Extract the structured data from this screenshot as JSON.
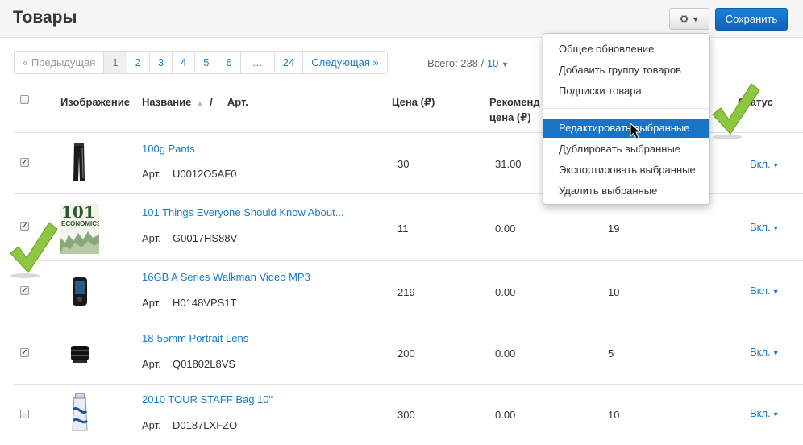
{
  "header": {
    "title": "Товары",
    "save_label": "Сохранить"
  },
  "pagination": {
    "prev": "« Предыдущая",
    "pages": [
      "1",
      "2",
      "3",
      "4",
      "5",
      "6",
      "…",
      "24"
    ],
    "active_page": "1",
    "next": "Следующая »",
    "total_label": "Всего: 238 /",
    "per_page": "10"
  },
  "table": {
    "headers": {
      "image": "Изображение",
      "name": "Название",
      "sort_indicator": "▲ /",
      "art": "Арт.",
      "price": "Цена (₽)",
      "recommended_line1": "Рекоменд",
      "recommended_line2": "цена (₽)",
      "status": "Статус"
    },
    "art_label": "Арт.",
    "rows": [
      {
        "name": "100g Pants",
        "art": "U0012O5AF0",
        "price": "30",
        "recommended": "31.00",
        "qty": "",
        "status": "Вкл.",
        "checked": true
      },
      {
        "name": "101 Things Everyone Should Know About...",
        "art": "G0017HS88V",
        "price": "11",
        "recommended": "0.00",
        "qty": "19",
        "status": "Вкл.",
        "checked": true
      },
      {
        "name": "16GB A Series Walkman Video MP3",
        "art": "H0148VPS1T",
        "price": "219",
        "recommended": "0.00",
        "qty": "10",
        "status": "Вкл.",
        "checked": true
      },
      {
        "name": "18-55mm Portrait Lens",
        "art": "Q01802L8VS",
        "price": "200",
        "recommended": "0.00",
        "qty": "5",
        "status": "Вкл.",
        "checked": true
      },
      {
        "name": "2010 TOUR STAFF Bag 10\"",
        "art": "D0187LXFZO",
        "price": "300",
        "recommended": "0.00",
        "qty": "10",
        "status": "Вкл.",
        "checked": false
      }
    ]
  },
  "dropdown": {
    "items": [
      "Общее обновление",
      "Добавить группу товаров",
      "Подписки товара",
      "Редактировать выбранные",
      "Дублировать выбранные",
      "Экспортировать выбранные",
      "Удалить выбранные"
    ],
    "highlighted_index": 3
  },
  "book_cover": {
    "big": "101",
    "sub": "ECONOMICS"
  },
  "colors": {
    "link": "#1a7bc9",
    "primary_button": "#0d63b9",
    "highlight": "#1a74c6",
    "checkmark": "#8dc63f"
  }
}
